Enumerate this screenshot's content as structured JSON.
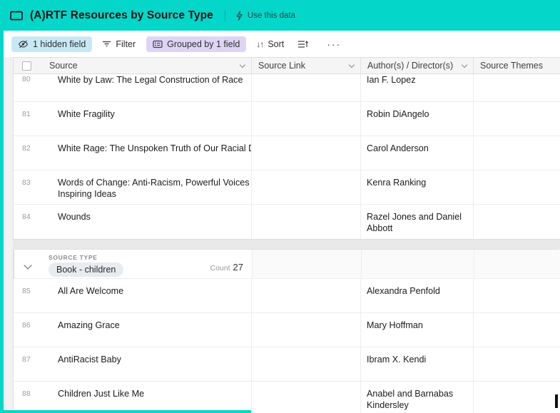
{
  "colors": {
    "teal": "#05d6ca",
    "hidden_field_bg": "#c7e9f6",
    "grouped_bg": "#ded5f5"
  },
  "header": {
    "title": "(A)RTF Resources by Source Type",
    "use_data_label": "Use this data"
  },
  "toolbar": {
    "hidden_field_label": "1 hidden field",
    "filter_label": "Filter",
    "grouped_label": "Grouped by 1 field",
    "sort_label": "Sort",
    "more_label": "···"
  },
  "grid": {
    "columns": [
      "Source",
      "Source Link",
      "Author(s) / Director(s)",
      "Source Themes"
    ],
    "group1_rows": [
      {
        "num": "80",
        "source": "White by Law: The Legal Construction of Race",
        "link": "",
        "author": "Ian F. Lopez",
        "themes": ""
      },
      {
        "num": "81",
        "source": "White Fragility",
        "link": "",
        "author": "Robin DiAngelo",
        "themes": ""
      },
      {
        "num": "82",
        "source": "White Rage: The Unspoken Truth of Our Racial Divide",
        "link": "",
        "author": "Carol Anderson",
        "themes": ""
      },
      {
        "num": "83",
        "source": "Words of Change: Anti-Racism, Powerful Voices\nInspiring Ideas",
        "link": "",
        "author": "Kenra Ranking",
        "themes": ""
      },
      {
        "num": "84",
        "source": "Wounds",
        "link": "",
        "author": "Razel Jones and Daniel\nAbbott",
        "themes": ""
      }
    ],
    "group2_header": {
      "field_label": "SOURCE TYPE",
      "value": "Book - children",
      "count_label": "Count",
      "count": "27"
    },
    "group2_rows": [
      {
        "num": "85",
        "source": "All Are Welcome",
        "link": "",
        "author": "Alexandra Penfold",
        "themes": ""
      },
      {
        "num": "86",
        "source": "Amazing Grace",
        "link": "",
        "author": "Mary Hoffman",
        "themes": ""
      },
      {
        "num": "87",
        "source": "AntiRacist Baby",
        "link": "",
        "author": "Ibram X. Kendi",
        "themes": ""
      },
      {
        "num": "88",
        "source": "Children Just Like Me",
        "link": "",
        "author": "Anabel and Barnabas\nKindersley",
        "themes": ""
      }
    ]
  }
}
